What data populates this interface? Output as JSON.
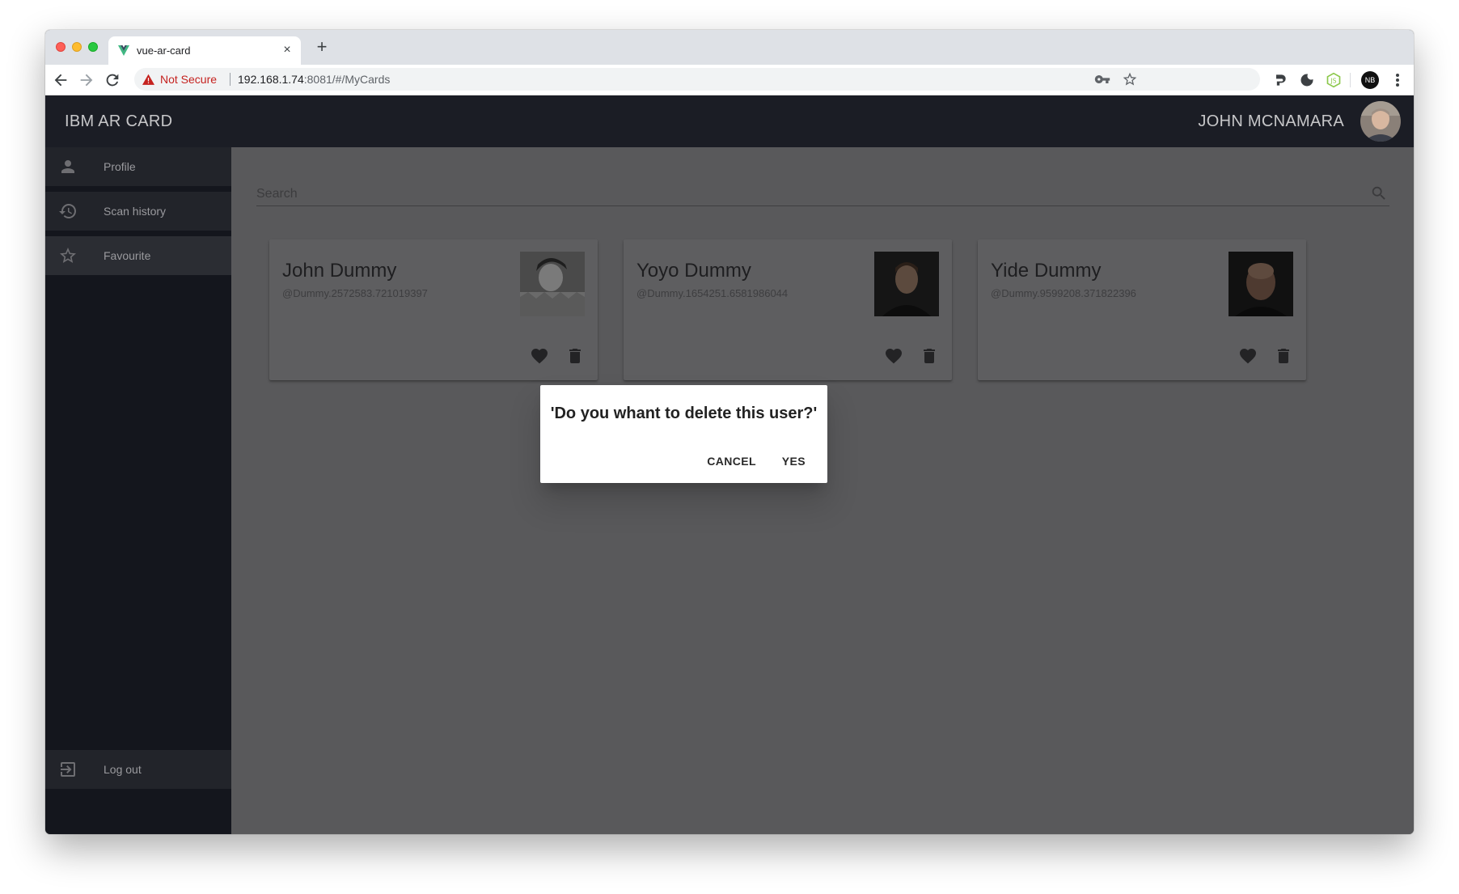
{
  "browser": {
    "tab_title": "vue-ar-card",
    "new_tab": "+",
    "close_tab": "×",
    "security_label": "Not Secure",
    "url_host": "192.168.1.74",
    "url_rest": ":8081/#/MyCards",
    "profile_initials": "NB"
  },
  "app": {
    "title": "IBM AR CARD",
    "user_name": "JOHN MCNAMARA"
  },
  "sidebar": {
    "items": [
      {
        "label": "Profile",
        "icon": "person-icon"
      },
      {
        "label": "Scan history",
        "icon": "history-icon"
      },
      {
        "label": "Favourite",
        "icon": "star-icon"
      }
    ],
    "logout": {
      "label": "Log out",
      "icon": "logout-icon"
    }
  },
  "search": {
    "label": "Search"
  },
  "cards": [
    {
      "name": "John Dummy",
      "handle": "@Dummy.2572583.721019397"
    },
    {
      "name": "Yoyo Dummy",
      "handle": "@Dummy.1654251.6581986044"
    },
    {
      "name": "Yide Dummy",
      "handle": "@Dummy.9599208.371822396"
    }
  ],
  "dialog": {
    "message": "'Do you whant to delete this user?'",
    "cancel_label": "CANCEL",
    "confirm_label": "YES"
  },
  "colors": {
    "appbar": "#1b1d25",
    "sidebar": "#14161d",
    "overlay_main": "#59595b",
    "warning_red": "#c5221f",
    "vue_green": "#41b883"
  }
}
